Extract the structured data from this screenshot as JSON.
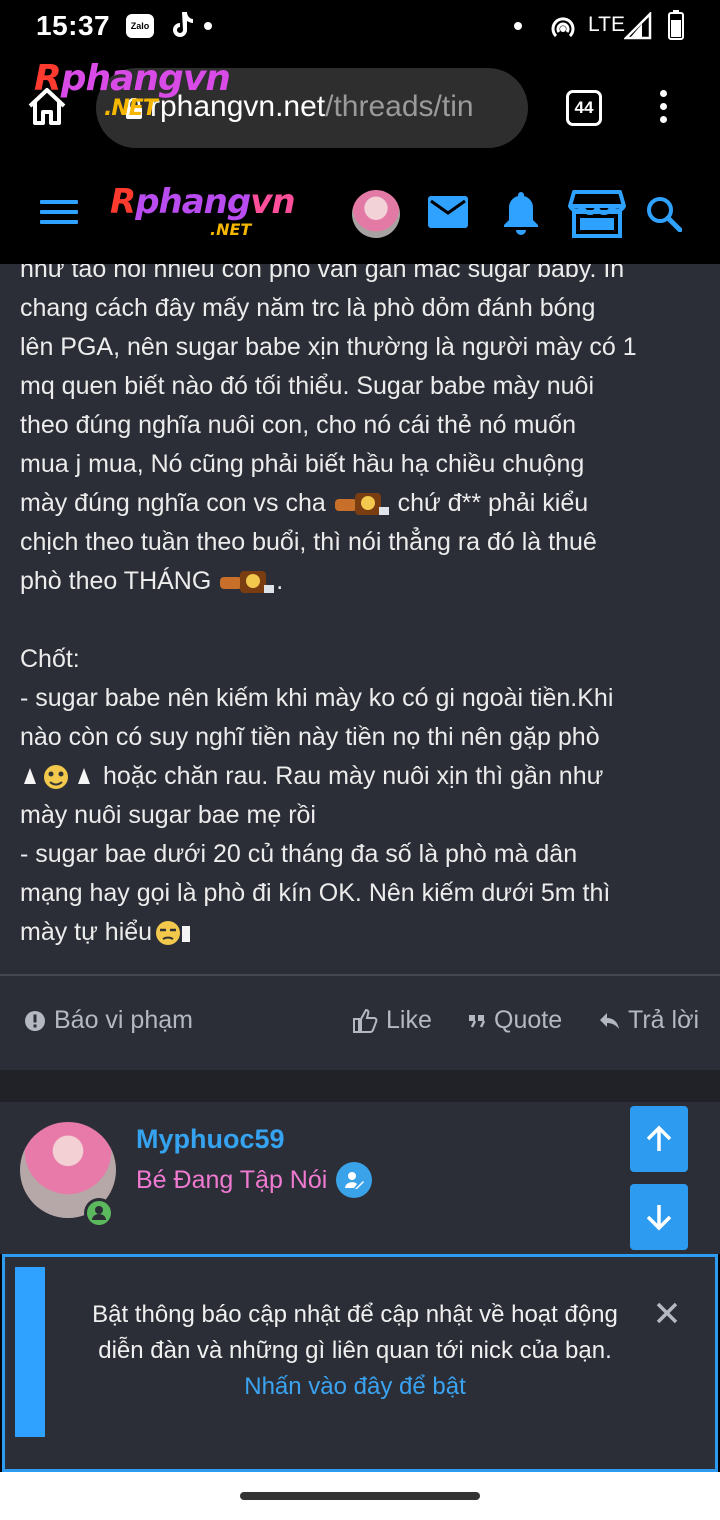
{
  "statusbar": {
    "time": "15:37",
    "zalo": "Zalo",
    "network": "LTE"
  },
  "browser": {
    "url_host": "rphangvn.net",
    "url_path": "/threads/tin",
    "tab_count": "44"
  },
  "site": {
    "logo_main": "Rphangvn",
    "logo_net": ".NET"
  },
  "post": {
    "lines": [
      "như tao nói nhiều con phò vẫn gắn mác sugar baby. Ih",
      "chang cách đây mấy năm trc là phò dỏm đánh bóng",
      "lên PGA, nên sugar babe xịn thường là người mày có 1",
      "mq quen biết nào đó tối thiểu. Sugar babe mày nuôi",
      "theo đúng nghĩa nuôi con, cho nó cái thẻ nó muốn",
      "mua j mua, Nó cũng phải biết hầu hạ chiều chuộng"
    ],
    "line7a": "mày đúng nghĩa con vs cha",
    "line7b": "chứ đ** phải kiểu",
    "line8": "chịch theo tuần theo buổi, thì nói thẳng ra đó là thuê",
    "line9a": "phò theo THÁNG",
    "line9b": ".",
    "chot": "Chốt:",
    "bullet1_l1": "- sugar babe nên kiếm khi mày ko có gi ngoài tiền.Khi",
    "bullet1_l2": "nào còn có suy nghĩ tiền này tiền nọ thi nên gặp phò",
    "bullet1_l3": "hoặc chăn rau. Rau mày nuôi xịn thì gần như",
    "bullet1_l4": "mày nuôi sugar bae mẹ rồi",
    "bullet2_l1": "- sugar bae dưới 20 củ tháng đa số là phò mà dân",
    "bullet2_l2": "mạng hay gọi là phò đi kín OK. Nên kiếm dưới 5m thì",
    "bullet2_l3": "mày tự hiểu"
  },
  "actions": {
    "report": "Báo vi phạm",
    "like": "Like",
    "quote": "Quote",
    "reply": "Trả lời"
  },
  "next_post": {
    "username": "Myphuoc59",
    "user_title": "Bé Đang Tập Nói"
  },
  "notification": {
    "line1": "Bật thông báo cập nhật để cập nhật về hoạt động",
    "line2": "diễn đàn và những gì liên quan tới nick của bạn.",
    "link": "Nhấn vào đây để bật"
  },
  "colors": {
    "accent": "#2c9bf0",
    "username": "#35a3f0",
    "user_title": "#f07ad1",
    "post_bg": "#2b2e36"
  },
  "icons": [
    "home-icon",
    "lock-icon",
    "tabs-icon",
    "more-vert-icon",
    "hamburger-icon",
    "mail-icon",
    "bell-icon",
    "store-icon",
    "search-icon",
    "alert-icon",
    "thumbs-up-icon",
    "quote-icon",
    "reply-icon",
    "arrow-up-icon",
    "arrow-down-icon",
    "close-icon"
  ]
}
